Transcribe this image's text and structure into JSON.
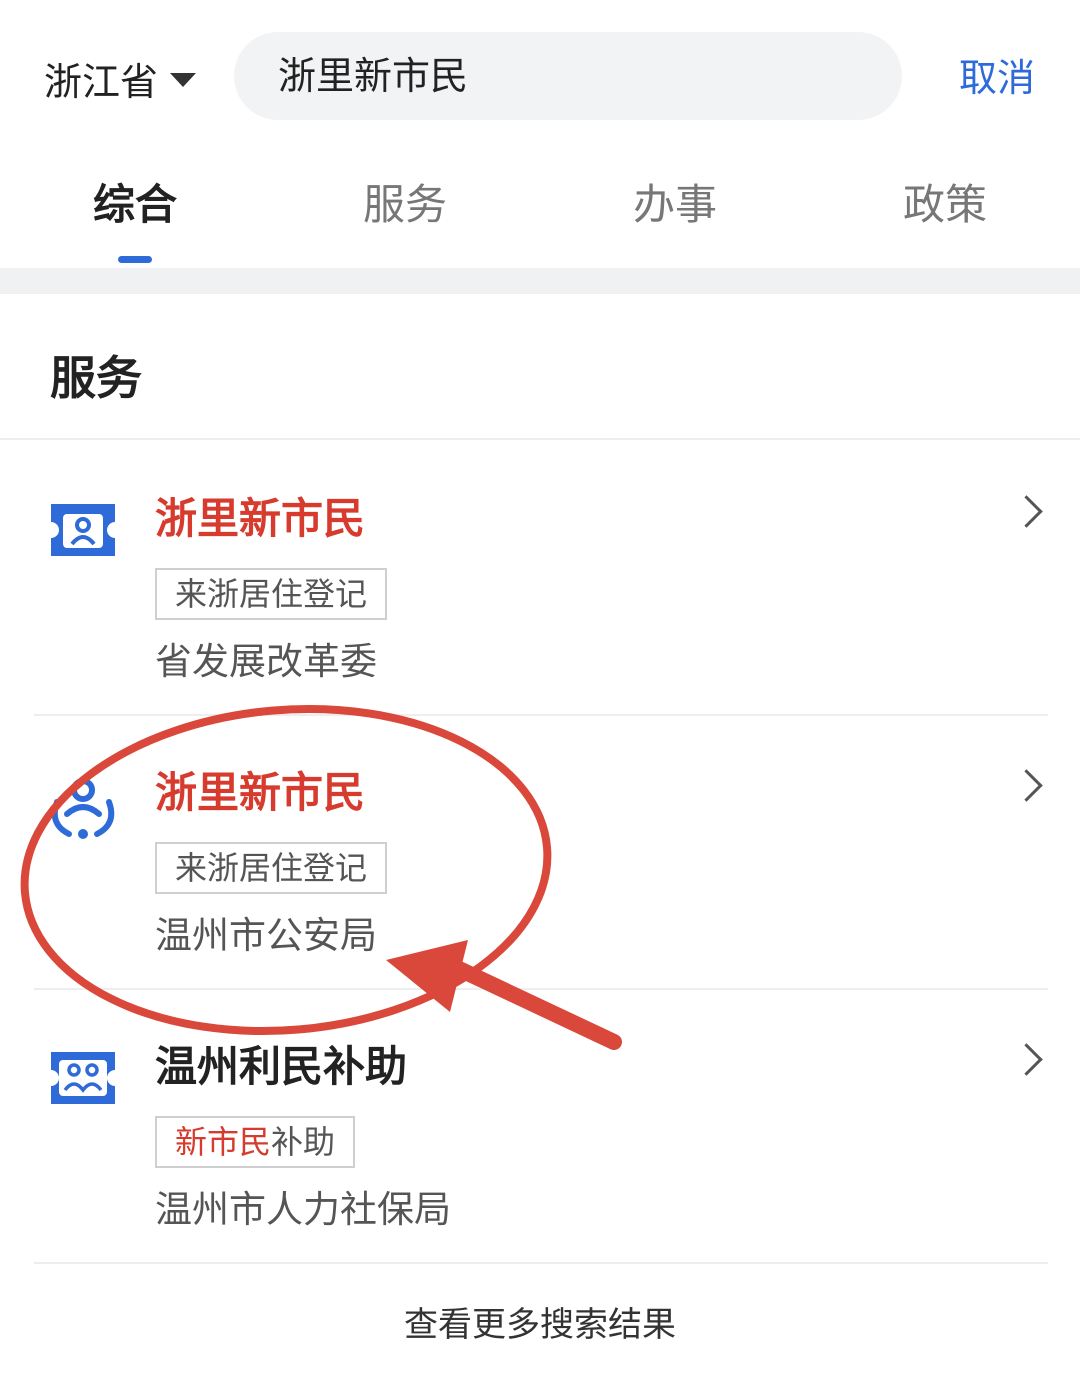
{
  "header": {
    "region": "浙江省",
    "search_value": "浙里新市民",
    "cancel_label": "取消"
  },
  "tabs": [
    {
      "label": "综合",
      "active": true
    },
    {
      "label": "服务",
      "active": false
    },
    {
      "label": "办事",
      "active": false
    },
    {
      "label": "政策",
      "active": false
    }
  ],
  "section": {
    "title": "服务"
  },
  "results": [
    {
      "title": "浙里新市民",
      "tag": "来浙居住登记",
      "department": "省发展改革委",
      "icon": "id-card-icon"
    },
    {
      "title": "浙里新市民",
      "tag": "来浙居住登记",
      "department": "温州市公安局",
      "icon": "people-care-icon"
    },
    {
      "title": "温州利民补助",
      "tag_highlight": "新市民",
      "tag_rest": "补助",
      "department": "温州市人力社保局",
      "icon": "group-card-icon"
    }
  ],
  "more_label": "查看更多搜索结果",
  "colors": {
    "accent_blue": "#2f6bd8",
    "title_red": "#d63b2d",
    "annotation_red": "#d9483b"
  }
}
